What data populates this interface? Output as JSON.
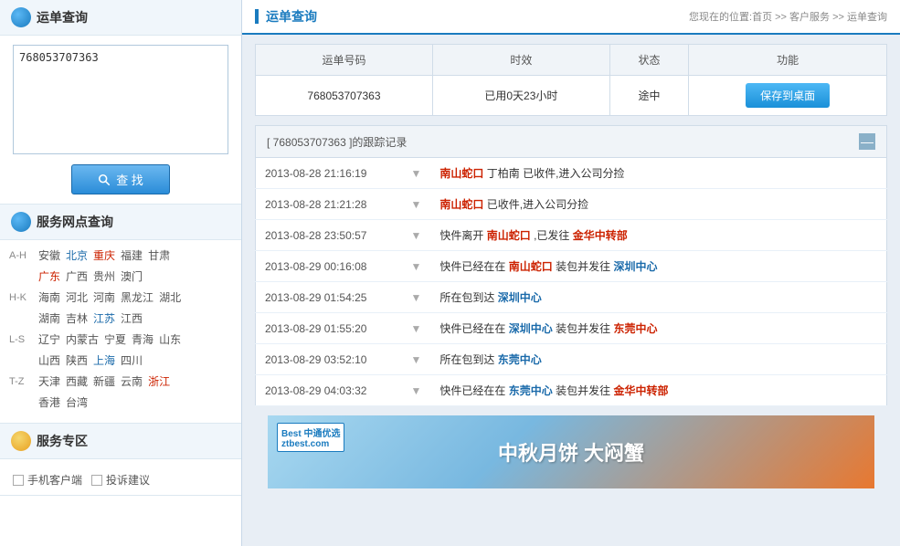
{
  "sidebar": {
    "title1": "运单查询",
    "tracking_value": "768053707363",
    "search_label": "查 找",
    "title2": "服务网点查询",
    "provinces": {
      "ah_label": "A-H",
      "ah": [
        {
          "name": "安徽",
          "highlight": ""
        },
        {
          "name": "北京",
          "highlight": "blue"
        },
        {
          "name": "重庆",
          "highlight": "red"
        },
        {
          "name": "福建",
          "highlight": ""
        },
        {
          "name": "甘肃",
          "highlight": ""
        }
      ],
      "guangdong": [
        {
          "name": "广东",
          "highlight": "red"
        },
        {
          "name": "广西",
          "highlight": ""
        },
        {
          "name": "贵州",
          "highlight": ""
        },
        {
          "name": "澳门",
          "highlight": ""
        }
      ],
      "hk_label": "H-K",
      "hk": [
        {
          "name": "海南",
          "highlight": ""
        },
        {
          "name": "河北",
          "highlight": ""
        },
        {
          "name": "河南",
          "highlight": ""
        },
        {
          "name": "黑龙江",
          "highlight": ""
        },
        {
          "name": "湖北",
          "highlight": ""
        }
      ],
      "hunan": [
        {
          "name": "湖南",
          "highlight": ""
        },
        {
          "name": "吉林",
          "highlight": ""
        },
        {
          "name": "江苏",
          "highlight": "blue"
        },
        {
          "name": "江西",
          "highlight": ""
        }
      ],
      "ls_label": "L-S",
      "ls": [
        {
          "name": "辽宁",
          "highlight": ""
        },
        {
          "name": "内蒙古",
          "highlight": ""
        },
        {
          "name": "宁夏",
          "highlight": ""
        },
        {
          "name": "青海",
          "highlight": ""
        },
        {
          "name": "山东",
          "highlight": ""
        }
      ],
      "shanxi": [
        {
          "name": "山西",
          "highlight": ""
        },
        {
          "name": "陕西",
          "highlight": ""
        },
        {
          "name": "上海",
          "highlight": "blue"
        },
        {
          "name": "四川",
          "highlight": ""
        }
      ],
      "tz_label": "T-Z",
      "tz": [
        {
          "name": "天津",
          "highlight": ""
        },
        {
          "name": "西藏",
          "highlight": ""
        },
        {
          "name": "新疆",
          "highlight": ""
        },
        {
          "name": "云南",
          "highlight": ""
        },
        {
          "name": "浙江",
          "highlight": "red"
        }
      ],
      "hk2": [
        {
          "name": "香港",
          "highlight": ""
        },
        {
          "name": "台湾",
          "highlight": ""
        }
      ]
    },
    "title3": "服务专区",
    "service_items": [
      {
        "label": "手机客户端",
        "checked": false
      },
      {
        "label": "投诉建议",
        "checked": false
      }
    ]
  },
  "header": {
    "title": "运单查询",
    "breadcrumb": "您现在的位置:首页 >> 客户服务 >> 运单查询"
  },
  "table": {
    "cols": [
      "运单号码",
      "时效",
      "状态",
      "功能"
    ],
    "row": {
      "number": "768053707363",
      "timeliness": "已用0天23小时",
      "status": "途中",
      "save_label": "保存到桌面"
    }
  },
  "tracking": {
    "header": "[ 768053707363 ]的跟踪记录",
    "collapse_label": "—",
    "records": [
      {
        "time": "2013-08-28 21:16:19",
        "info_plain": "已收件,进入公司分捡",
        "info_pre": "",
        "location": "南山蛇口",
        "location2": "丁柏南",
        "info_suffix": "已收件,进入公司分捡",
        "format": "loc_person_suffix"
      },
      {
        "time": "2013-08-28 21:21:28",
        "info_plain": "已收件,进入公司分捡",
        "location": "南山蛇口",
        "info_suffix": "已收件,进入公司分捡",
        "format": "loc_suffix"
      },
      {
        "time": "2013-08-28 23:50:57",
        "info_pre": "快件离开",
        "location": "南山蛇口",
        "info_mid": ",已发往",
        "location2": "金华中转部",
        "format": "pre_loc_mid_loc2"
      },
      {
        "time": "2013-08-29 00:16:08",
        "info_pre": "快件已经在在",
        "location": "南山蛇口",
        "info_mid": "装包并发往",
        "location2": "深圳中心",
        "format": "pre_loc_mid_loc2"
      },
      {
        "time": "2013-08-29 01:54:25",
        "info_pre": "所在包到达",
        "location": "深圳中心",
        "format": "pre_loc"
      },
      {
        "time": "2013-08-29 01:55:20",
        "info_pre": "快件已经在在",
        "location": "深圳中心",
        "info_mid": "装包并发往",
        "location2": "东莞中心",
        "format": "pre_loc_mid_loc2"
      },
      {
        "time": "2013-08-29 03:52:10",
        "info_pre": "所在包到达",
        "location": "东莞中心",
        "format": "pre_loc"
      },
      {
        "time": "2013-08-29 04:03:32",
        "info_pre": "快件已经在在",
        "location": "东莞中心",
        "info_mid": "装包并发往",
        "location2": "金华中转部",
        "format": "pre_loc_mid_loc2"
      }
    ]
  },
  "banner": {
    "logo_text": "Best 中通优选\nztbest.com",
    "text": "中秋月饼  大闷蟹"
  }
}
